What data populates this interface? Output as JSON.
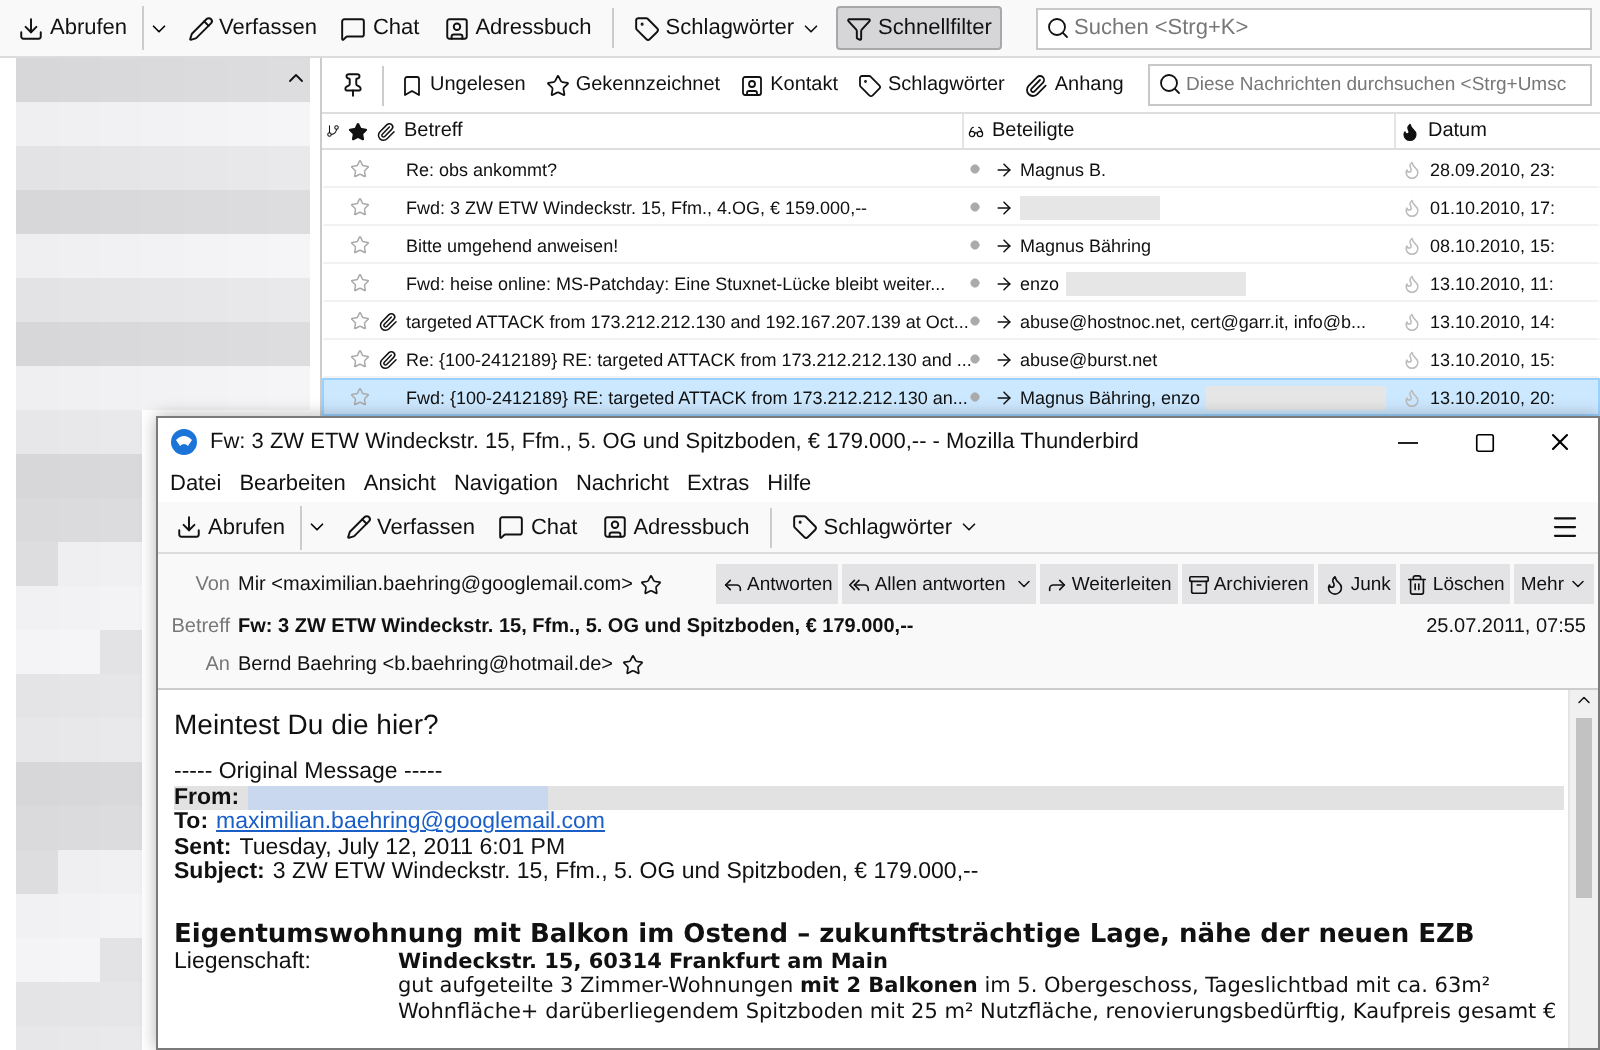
{
  "main_toolbar": {
    "buttons": [
      {
        "label": "Abrufen",
        "kind": "split",
        "selected": false
      },
      {
        "label": "Verfassen",
        "kind": "plain",
        "selected": false
      },
      {
        "label": "Chat",
        "kind": "plain",
        "selected": false
      },
      {
        "label": "Adressbuch",
        "kind": "plain",
        "selected": false
      },
      {
        "label": "Schlagwörter",
        "kind": "menu",
        "selected": false
      },
      {
        "label": "Schnellfilter",
        "kind": "plain",
        "selected": true
      }
    ],
    "search": {
      "placeholder": "Suchen <Strg+K>"
    }
  },
  "quick_filter": {
    "buttons": [
      {
        "label": "Ungelesen",
        "selected": false
      },
      {
        "label": "Gekennzeichnet",
        "selected": false
      },
      {
        "label": "Kontakt",
        "selected": false
      },
      {
        "label": "Schlagwörter",
        "selected": false
      },
      {
        "label": "Anhang",
        "selected": false
      }
    ],
    "search": {
      "placeholder": "Diese Nachrichten durchsuchen <Strg+Umsc"
    }
  },
  "message_list": {
    "columns": {
      "subject": "Betreff",
      "participants": "Beteiligte",
      "date": "Datum"
    },
    "rows": [
      {
        "subject": "Re: obs ankommt?",
        "participants": "Magnus B.",
        "redacted": false,
        "attachment": false,
        "starred": false,
        "date": "28.09.2010, 23:",
        "selected": false
      },
      {
        "subject": "Fwd: 3 ZW ETW Windeckstr. 15, Ffm., 4.OG, € 159.000,--",
        "redacted": true,
        "attachment": false,
        "starred": false,
        "date": "01.10.2010, 17:",
        "selected": false
      },
      {
        "subject": "Bitte umgehend anweisen!",
        "participants": "Magnus Bähring",
        "redacted": false,
        "attachment": false,
        "starred": false,
        "date": "08.10.2010, 15:",
        "selected": false
      },
      {
        "subject": "Fwd: heise online: MS-Patchday: Eine Stuxnet-Lücke bleibt weiter...",
        "participants": "enzo",
        "redacted": true,
        "attachment": false,
        "starred": false,
        "date": "13.10.2010, 11:",
        "selected": false
      },
      {
        "subject": "targeted ATTACK from 173.212.212.130 and 192.167.207.139 at Oct...",
        "participants": "abuse@hostnoc.net, cert@garr.it, info@b...",
        "redacted": false,
        "attachment": true,
        "starred": false,
        "date": "13.10.2010, 14:",
        "selected": false
      },
      {
        "subject": "Re: {100-2412189} RE: targeted ATTACK from 173.212.212.130 and ...",
        "participants": "abuse@burst.net",
        "redacted": false,
        "attachment": true,
        "starred": false,
        "date": "13.10.2010, 15:",
        "selected": false
      },
      {
        "subject": "Fwd: {100-2412189} RE: targeted ATTACK from 173.212.212.130 an...",
        "participants": "Magnus Bähring, enzo",
        "redacted": true,
        "attachment": false,
        "starred": false,
        "date": "13.10.2010, 20:",
        "selected": true
      }
    ]
  },
  "message_window": {
    "title": "Fw: 3 ZW ETW Windeckstr. 15, Ffm., 5. OG und Spitzboden, € 179.000,-- - Mozilla Thunderbird",
    "menu": [
      "Datei",
      "Bearbeiten",
      "Ansicht",
      "Navigation",
      "Nachricht",
      "Extras",
      "Hilfe"
    ],
    "toolbar": [
      {
        "label": "Abrufen",
        "kind": "split"
      },
      {
        "label": "Verfassen",
        "kind": "plain"
      },
      {
        "label": "Chat",
        "kind": "plain"
      },
      {
        "label": "Adressbuch",
        "kind": "plain"
      },
      {
        "label": "Schlagwörter",
        "kind": "menu"
      }
    ],
    "from": {
      "label": "Von",
      "value": "Mir <maximilian.baehring@googlemail.com>"
    },
    "actions": [
      {
        "label": "Antworten",
        "kind": "plain"
      },
      {
        "label": "Allen antworten",
        "kind": "split"
      },
      {
        "label": "Weiterleiten",
        "kind": "plain"
      },
      {
        "label": "Archivieren",
        "kind": "plain"
      },
      {
        "label": "Junk",
        "kind": "plain"
      },
      {
        "label": "Löschen",
        "kind": "plain"
      },
      {
        "label": "Mehr",
        "kind": "menu"
      }
    ],
    "subject": {
      "label": "Betreff",
      "value": "Fw: 3 ZW ETW Windeckstr. 15, Ffm., 5. OG und Spitzboden, € 179.000,--",
      "date": "25.07.2011, 07:55"
    },
    "to": {
      "label": "An",
      "value": "Bernd Baehring <b.baehring@hotmail.de>"
    },
    "body": {
      "greeting": "Meintest Du die hier?",
      "original_header": "----- Original Message -----",
      "fields": [
        {
          "label": "From:",
          "kind": "redacted",
          "highlighted": true
        },
        {
          "label": "To:",
          "value": "maximilian.baehring@googlemail.com",
          "kind": "link",
          "highlighted": false
        },
        {
          "label": "Sent:",
          "value": "Tuesday, July 12, 2011 6:01 PM",
          "kind": "text",
          "highlighted": false
        },
        {
          "label": "Subject:",
          "value": "3 ZW ETW Windeckstr. 15, Ffm., 5. OG und Spitzboden, € 179.000,--",
          "kind": "text",
          "highlighted": false
        }
      ],
      "heading": "Eigentumswohnung mit Balkon im Ostend – zukunftsträchtige Lage, nähe der neuen EZB",
      "property_label": "Liegenschaft:",
      "property_address": "Windeckstr. 15, 60314 Frankfurt am Main",
      "property_text": "gut aufgeteilte 3 Zimmer-Wohnungen **mit 2 Balkonen** im 5. Obergeschoss, Tageslichtbad mit ca. 63m² Wohnfläche+ darüberliegendem Spitzboden mit 25 m² Nutzfläche, renovierungsbedürftig, Kaufpreis gesamt €"
    }
  }
}
